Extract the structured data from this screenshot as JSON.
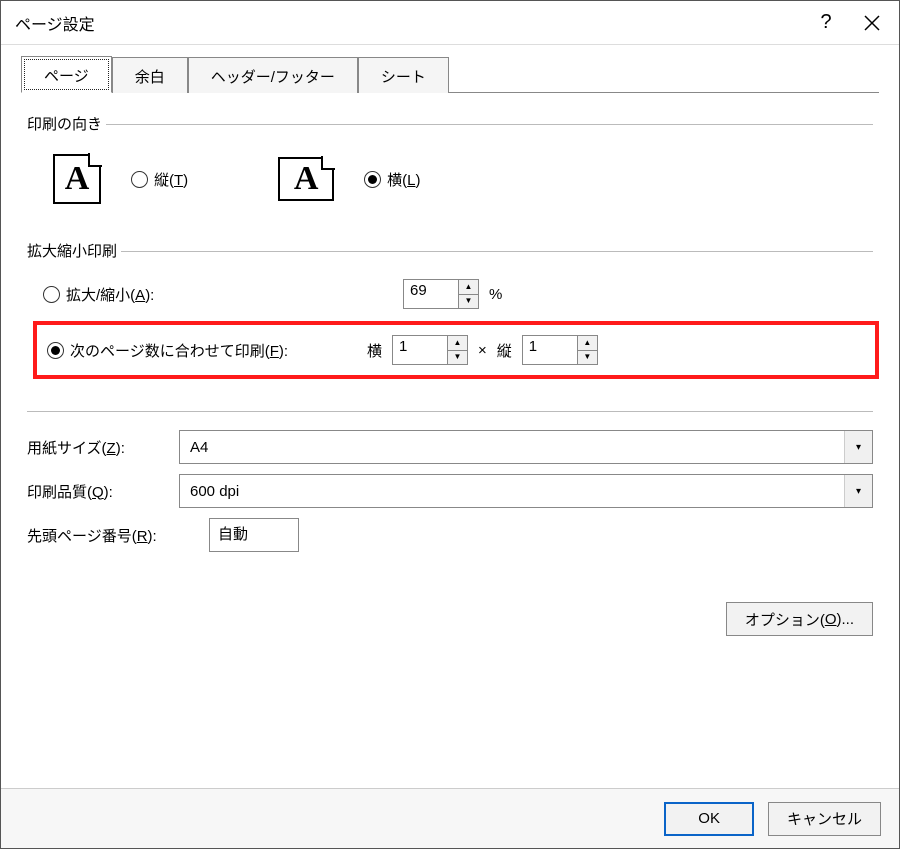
{
  "window": {
    "title": "ページ設定",
    "help": "?",
    "close": "×"
  },
  "tabs": {
    "page": "ページ",
    "margins": "余白",
    "headerfooter": "ヘッダー/フッター",
    "sheet": "シート"
  },
  "orientation": {
    "group_label": "印刷の向き",
    "portrait_pre": "縦(",
    "portrait_key": "T",
    "portrait_post": ")",
    "landscape_pre": "横(",
    "landscape_key": "L",
    "landscape_post": ")",
    "selected": "landscape",
    "icon_letter": "A"
  },
  "scaling": {
    "group_label": "拡大縮小印刷",
    "adjust_pre": "拡大/縮小(",
    "adjust_key": "A",
    "adjust_post": "):",
    "adjust_value": "69",
    "percent": "%",
    "fit_pre": "次のページ数に合わせて印刷(",
    "fit_key": "F",
    "fit_post": "):",
    "wide_label": "横",
    "wide_value": "1",
    "times": "×",
    "tall_label": "縦",
    "tall_value": "1",
    "selected": "fit"
  },
  "paper": {
    "label_pre": "用紙サイズ(",
    "label_key": "Z",
    "label_post": "):",
    "value": "A4"
  },
  "quality": {
    "label_pre": "印刷品質(",
    "label_key": "Q",
    "label_post": "):",
    "value": "600 dpi"
  },
  "firstpage": {
    "label_pre": "先頭ページ番号(",
    "label_key": "R",
    "label_post": "):",
    "value": "自動"
  },
  "buttons": {
    "options_pre": "オプション(",
    "options_key": "O",
    "options_post": ")...",
    "ok": "OK",
    "cancel": "キャンセル"
  }
}
